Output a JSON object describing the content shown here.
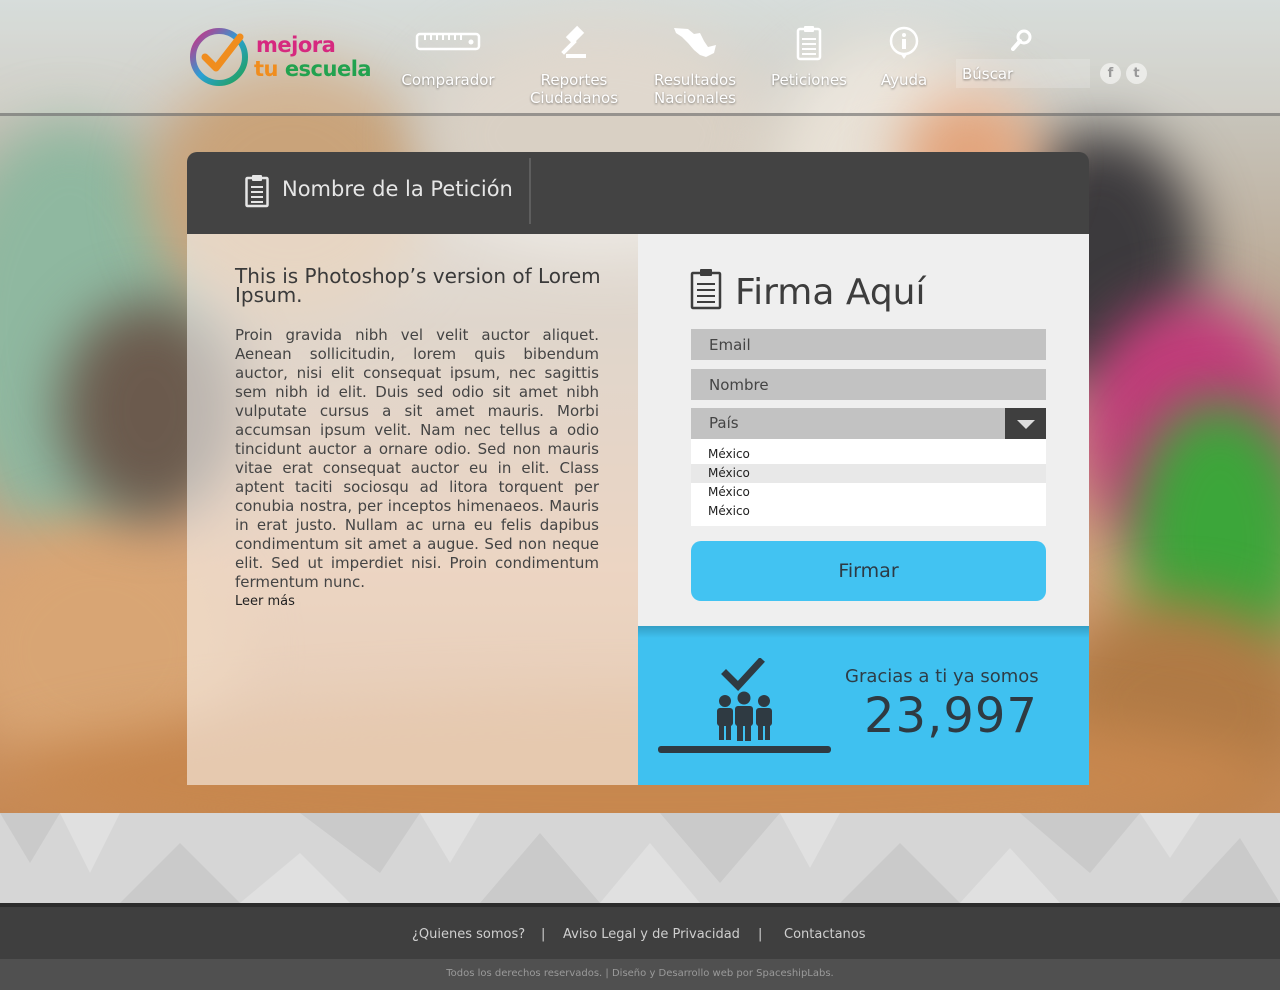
{
  "brand": {
    "line1": "mejora",
    "line2_a": "tu",
    "line2_b": "escuela"
  },
  "nav": {
    "comparador": "Comparador",
    "reportes_1": "Reportes",
    "reportes_2": "Ciudadanos",
    "resultados_1": "Resultados",
    "resultados_2": "Nacionales",
    "peticiones": "Peticiones",
    "ayuda": "Ayuda",
    "buscar_placeholder": "Búscar"
  },
  "social": {
    "facebook": "f",
    "twitter": "t"
  },
  "petition": {
    "header_title": "Nombre de la Petición",
    "body_title": "This is Photoshop’s version  of Lorem Ipsum.",
    "body_text": "Proin gravida nibh vel velit auctor aliquet. Aenean sollicitudin, lorem quis bibendum auctor, nisi elit consequat ipsum, nec sagittis sem nibh id elit. Duis sed odio sit amet nibh vulputate cursus a sit amet mauris. Morbi accumsan ipsum velit. Nam nec tellus a odio tincidunt auctor a ornare odio. Sed non  mauris vitae erat consequat auctor eu in elit. Class aptent taciti sociosqu ad litora torquent per conubia nostra, per inceptos himenaeos. Mauris in erat justo. Nullam ac urna eu felis dapibus condimentum sit amet a augue. Sed non neque elit. Sed ut imperdiet nisi. Proin condimentum fermentum nunc.",
    "read_more": "Leer más"
  },
  "sign_form": {
    "title": "Firma Aquí",
    "email_placeholder": "Email",
    "name_placeholder": "Nombre",
    "country_label": "País",
    "country_options": [
      "México",
      "México",
      "México",
      "México"
    ],
    "submit_label": "Firmar"
  },
  "counter": {
    "label": "Gracias a ti ya somos",
    "value": "23,997"
  },
  "footer": {
    "about": "¿Quienes somos?",
    "legal": "Aviso Legal  y  de Privacidad",
    "contact": "Contactanos",
    "separator": "|",
    "copyright": "Todos los derechos reservados. | Diseño y Desarrollo web por SpaceshipLabs."
  },
  "colors": {
    "accent_blue": "#3fc1f0",
    "dark_header": "#434343",
    "logo_pink": "#d6297f",
    "logo_orange": "#f08d1e",
    "logo_green": "#22a24f"
  },
  "icons": {
    "comparador": "ruler-icon",
    "reportes": "gavel-icon",
    "resultados": "mexico-map-icon",
    "peticiones": "clipboard-icon",
    "ayuda": "info-icon",
    "buscar": "search-icon",
    "counter": "people-check-icon"
  }
}
